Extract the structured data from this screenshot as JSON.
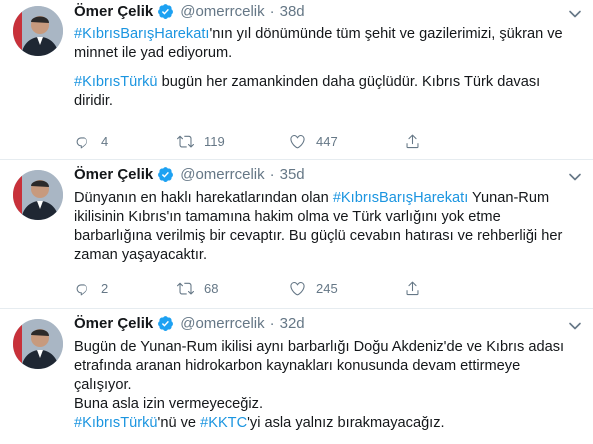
{
  "colors": {
    "accent": "#1b95e0",
    "text": "#14171a",
    "muted": "#657786",
    "verified": "#1da1f2"
  },
  "tweets": [
    {
      "name": "Ömer Çelik",
      "handle": "@omerrcelik",
      "sep": "·",
      "time": "38d",
      "body": [
        [
          [
            {
              "t": "#KıbrısBarışHarekatı",
              "tag": true
            },
            {
              "t": "'nın yıl dönümünde tüm şehit ve gazilerimizi, şükran ve"
            }
          ],
          [
            {
              "t": "minnet ile yad ediyorum."
            }
          ]
        ],
        [
          [
            {
              "t": "#KıbrısTürkü",
              "tag": true
            },
            {
              "t": " bugün her zamankinden daha güçlüdür. Kıbrıs Türk davası"
            }
          ],
          [
            {
              "t": "diridir."
            }
          ]
        ]
      ],
      "replies": "4",
      "retweets": "119",
      "likes": "447"
    },
    {
      "name": "Ömer Çelik",
      "handle": "@omerrcelik",
      "sep": "·",
      "time": "35d",
      "body": [
        [
          [
            {
              "t": "Dünyanın en haklı harekatlarından olan "
            },
            {
              "t": "#KıbrısBarışHarekatı",
              "tag": true
            },
            {
              "t": " Yunan-Rum"
            }
          ],
          [
            {
              "t": "ikilisinin Kıbrıs'ın tamamına hakim olma ve Türk varlığını yok etme"
            }
          ],
          [
            {
              "t": "barbarlığına verilmiş bir cevaptır. Bu güçlü cevabın hatırası ve  rehberliği her"
            }
          ],
          [
            {
              "t": "zaman yaşayacaktır."
            }
          ]
        ]
      ],
      "replies": "2",
      "retweets": "68",
      "likes": "245"
    },
    {
      "name": "Ömer Çelik",
      "handle": "@omerrcelik",
      "sep": "·",
      "time": "32d",
      "body": [
        [
          [
            {
              "t": "Bugün de Yunan-Rum ikilisi aynı barbarlığı Doğu Akdeniz'de ve Kıbrıs adası"
            }
          ],
          [
            {
              "t": "etrafında aranan hidrokarbon kaynakları konusunda devam ettirmeye"
            }
          ],
          [
            {
              "t": "çalışıyor."
            }
          ],
          [
            {
              "t": "Buna asla izin vermeyeceğiz."
            }
          ],
          [
            {
              "t": "#KıbrısTürkü",
              "tag": true
            },
            {
              "t": "'nü ve "
            },
            {
              "t": "#KKTC",
              "tag": true
            },
            {
              "t": "'yi asla yalnız bırakmayacağız."
            }
          ]
        ]
      ]
    }
  ]
}
